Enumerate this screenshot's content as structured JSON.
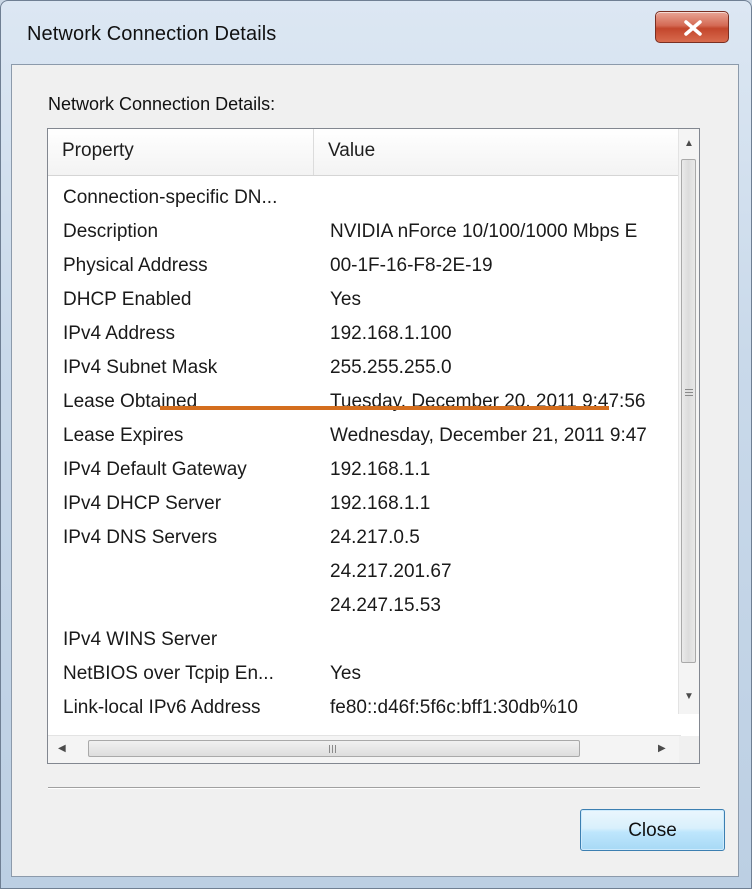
{
  "window": {
    "title": "Network Connection Details"
  },
  "group_label": "Network Connection Details:",
  "columns": {
    "property": "Property",
    "value": "Value"
  },
  "rows": [
    {
      "property": "Connection-specific DN...",
      "value": ""
    },
    {
      "property": "Description",
      "value": "NVIDIA nForce 10/100/1000 Mbps E"
    },
    {
      "property": "Physical Address",
      "value": "00-1F-16-F8-2E-19"
    },
    {
      "property": "DHCP Enabled",
      "value": "Yes"
    },
    {
      "property": "IPv4 Address",
      "value": "192.168.1.100"
    },
    {
      "property": "IPv4 Subnet Mask",
      "value": "255.255.255.0"
    },
    {
      "property": "Lease Obtained",
      "value": "Tuesday, December 20, 2011 9:47:56"
    },
    {
      "property": "Lease Expires",
      "value": "Wednesday, December 21, 2011 9:47"
    },
    {
      "property": "IPv4 Default Gateway",
      "value": "192.168.1.1"
    },
    {
      "property": "IPv4 DHCP Server",
      "value": "192.168.1.1"
    },
    {
      "property": "IPv4 DNS Servers",
      "value": "24.217.0.5"
    },
    {
      "property": "",
      "value": "24.217.201.67"
    },
    {
      "property": "",
      "value": "24.247.15.53"
    },
    {
      "property": "IPv4 WINS Server",
      "value": ""
    },
    {
      "property": "NetBIOS over Tcpip En...",
      "value": "Yes"
    },
    {
      "property": "Link-local IPv6 Address",
      "value": "fe80::d46f:5f6c:bff1:30db%10"
    }
  ],
  "buttons": {
    "close": "Close"
  },
  "icons": {
    "title_close": "close-x-icon",
    "scroll_up": "arrow-up-icon",
    "scroll_down": "arrow-down-icon",
    "scroll_left": "arrow-left-icon",
    "scroll_right": "arrow-right-icon"
  },
  "colors": {
    "annotation": "#d46e1e",
    "close_accent": "#c3462c"
  }
}
